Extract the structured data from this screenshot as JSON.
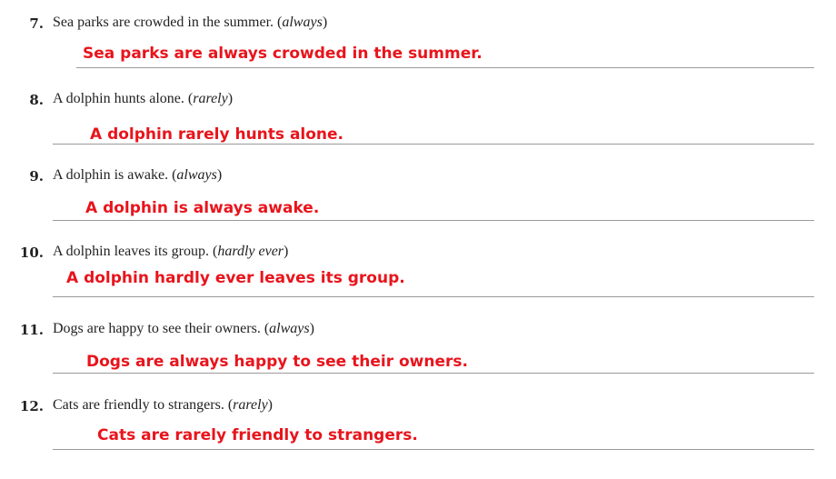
{
  "questions": [
    {
      "number": "7.",
      "prompt": "Sea parks are crowded in the summer.",
      "hint": "always",
      "answer": "Sea parks are always crowded in the summer."
    },
    {
      "number": "8.",
      "prompt": "A dolphin hunts alone.",
      "hint": "rarely",
      "answer": "A dolphin rarely hunts alone."
    },
    {
      "number": "9.",
      "prompt": "A dolphin is awake.",
      "hint": "always",
      "answer": "A dolphin is always awake."
    },
    {
      "number": "10.",
      "prompt": "A dolphin leaves its group.",
      "hint": "hardly ever",
      "answer": "A dolphin hardly ever leaves its group."
    },
    {
      "number": "11.",
      "prompt": "Dogs are happy to see their owners.",
      "hint": "always",
      "answer": "Dogs are always happy to see their owners."
    },
    {
      "number": "12.",
      "prompt": "Cats are friendly to strangers.",
      "hint": "rarely",
      "answer": "Cats are rarely friendly to strangers."
    }
  ],
  "colors": {
    "answer": "#e8141c",
    "text": "#222222",
    "line": "#9a9a9a"
  }
}
